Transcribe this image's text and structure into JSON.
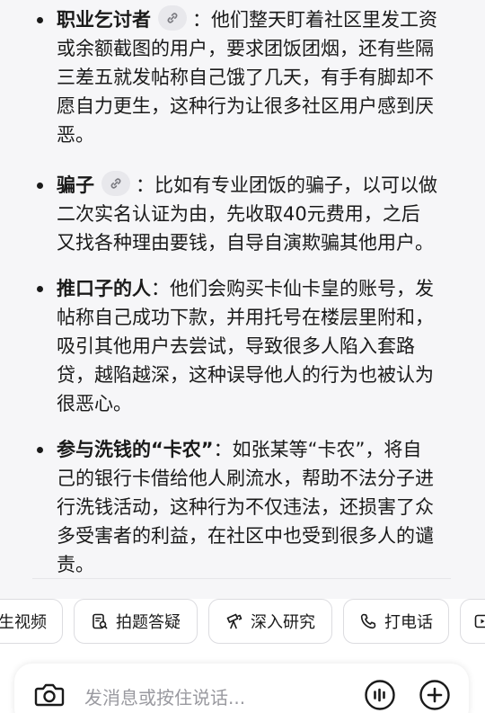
{
  "answer": {
    "items": [
      {
        "title": "职业乞讨者",
        "has_link": true,
        "text": "：他们整天盯着社区里发工资或余额截图的用户，要求团饭团烟，还有些隔三差五就发帖称自己饿了几天，有手有脚却不愿自力更生，这种行为让很多社区用户感到厌恶。"
      },
      {
        "title": "骗子",
        "has_link": true,
        "text": "：比如有专业团饭的骗子，以可以做二次实名认证为由，先收取40元费用，之后又找各种理由要钱，自导自演欺骗其他用户。"
      },
      {
        "title": "推口子的人",
        "has_link": false,
        "text": "：他们会购买卡仙卡皇的账号，发帖称自己成功下款，并用托号在楼层里附和，吸引其他用户去尝试，导致很多人陷入套路贷，越陷越深，这种误导他人的行为也被认为很恶心。"
      },
      {
        "title": "参与洗钱的“卡农”",
        "has_link": false,
        "text": "：如张某等“卡农”，将自己的银行卡借给他人刷流水，帮助不法分子进行洗钱活动，这种行为不仅违法，还损害了众多受害者的利益，在社区中也受到很多人的谴责。"
      }
    ]
  },
  "chips": [
    {
      "label": "生视频",
      "icon": "video-icon"
    },
    {
      "label": "拍题答疑",
      "icon": "photo-question-icon"
    },
    {
      "label": "深入研究",
      "icon": "telescope-icon"
    },
    {
      "label": "打电话",
      "icon": "phone-icon"
    },
    {
      "label": "",
      "icon": "play-icon"
    }
  ],
  "input": {
    "placeholder": "发消息或按住说话..."
  },
  "colors": {
    "text": "#1a1a1a",
    "card_bg": "#f6f6f8",
    "placeholder": "#9a9aa0",
    "chip_border": "#dcdce0"
  }
}
